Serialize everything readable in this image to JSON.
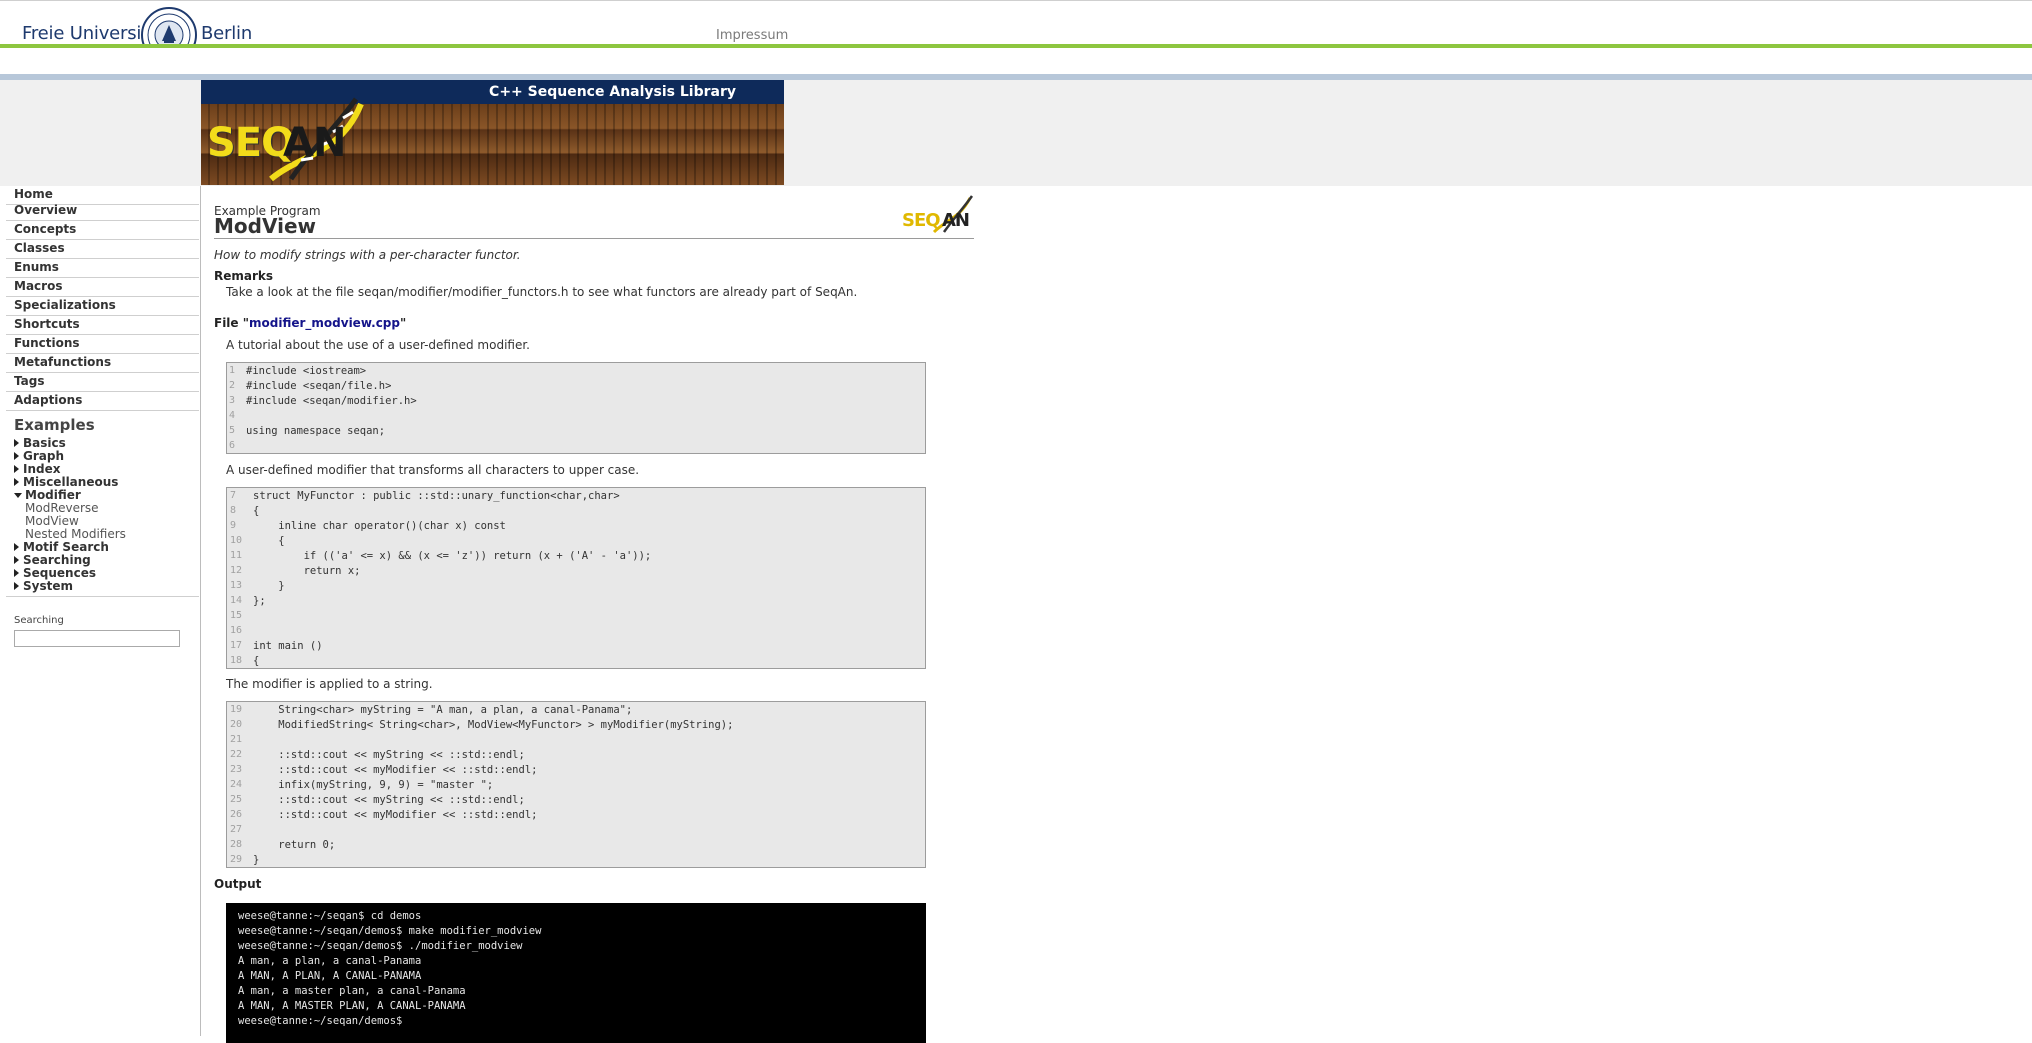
{
  "header": {
    "logo_left": "Freie Universität",
    "logo_right": "Berlin",
    "impressum": "Impressum"
  },
  "banner": {
    "tagline": "C++ Sequence Analysis Library",
    "logo_seq": "SEQ",
    "logo_an": "AN"
  },
  "sidebar": {
    "items": [
      "Home",
      "Overview",
      "Concepts",
      "Classes",
      "Enums",
      "Macros",
      "Specializations",
      "Shortcuts",
      "Functions",
      "Metafunctions",
      "Tags",
      "Adaptions"
    ],
    "examples_heading": "Examples",
    "examples": [
      {
        "label": "Basics",
        "expanded": false
      },
      {
        "label": "Graph",
        "expanded": false
      },
      {
        "label": "Index",
        "expanded": false
      },
      {
        "label": "Miscellaneous",
        "expanded": false
      },
      {
        "label": "Modifier",
        "expanded": true
      },
      {
        "label": "Motif Search",
        "expanded": false
      },
      {
        "label": "Searching",
        "expanded": false
      },
      {
        "label": "Sequences",
        "expanded": false
      },
      {
        "label": "System",
        "expanded": false
      }
    ],
    "modifier_children": [
      "ModReverse",
      "ModView",
      "Nested Modifiers"
    ],
    "search_label": "Searching",
    "search_value": ""
  },
  "main": {
    "overline": "Example Program",
    "title": "ModView",
    "logo_seq": "SEQ",
    "logo_an": "AN",
    "subtitle": "How to modify strings with a per-character functor.",
    "remarks_heading": "Remarks",
    "remarks_text": "Take a look at the file seqan/modifier/modifier_functors.h to see what functors are already part of SeqAn.",
    "file_prefix": "File \"",
    "file_name": "modifier_modview.cpp",
    "file_suffix": "\"",
    "para1": "A tutorial about the use of a user-defined modifier.",
    "code1": [
      {
        "n": "1",
        "t": "#include <iostream>"
      },
      {
        "n": "2",
        "t": "#include <seqan/file.h>"
      },
      {
        "n": "3",
        "t": "#include <seqan/modifier.h>"
      },
      {
        "n": "4",
        "t": ""
      },
      {
        "n": "5",
        "t": "using namespace seqan;"
      },
      {
        "n": "6",
        "t": ""
      }
    ],
    "para2": "A user-defined modifier that transforms all characters to upper case.",
    "code2": [
      {
        "n": "7",
        "t": "struct MyFunctor : public ::std::unary_function<char,char>"
      },
      {
        "n": "8",
        "t": "{"
      },
      {
        "n": "9",
        "t": "    inline char operator()(char x) const"
      },
      {
        "n": "10",
        "t": "    {"
      },
      {
        "n": "11",
        "t": "        if (('a' <= x) && (x <= 'z')) return (x + ('A' - 'a'));"
      },
      {
        "n": "12",
        "t": "        return x;"
      },
      {
        "n": "13",
        "t": "    }"
      },
      {
        "n": "14",
        "t": "};"
      },
      {
        "n": "15",
        "t": ""
      },
      {
        "n": "16",
        "t": ""
      },
      {
        "n": "17",
        "t": "int main ()"
      },
      {
        "n": "18",
        "t": "{"
      }
    ],
    "para3": "The modifier is applied to a string.",
    "code3": [
      {
        "n": "19",
        "t": "    String<char> myString = \"A man, a plan, a canal-Panama\";"
      },
      {
        "n": "20",
        "t": "    ModifiedString< String<char>, ModView<MyFunctor> > myModifier(myString);"
      },
      {
        "n": "21",
        "t": ""
      },
      {
        "n": "22",
        "t": "    ::std::cout << myString << ::std::endl;"
      },
      {
        "n": "23",
        "t": "    ::std::cout << myModifier << ::std::endl;"
      },
      {
        "n": "24",
        "t": "    infix(myString, 9, 9) = \"master \";"
      },
      {
        "n": "25",
        "t": "    ::std::cout << myString << ::std::endl;"
      },
      {
        "n": "26",
        "t": "    ::std::cout << myModifier << ::std::endl;"
      },
      {
        "n": "27",
        "t": ""
      },
      {
        "n": "28",
        "t": "    return 0;"
      },
      {
        "n": "29",
        "t": "}"
      }
    ],
    "output_heading": "Output",
    "output": [
      "weese@tanne:~/seqan$ cd demos",
      "weese@tanne:~/seqan/demos$ make modifier_modview",
      "weese@tanne:~/seqan/demos$ ./modifier_modview",
      "A man, a plan, a canal-Panama",
      "A MAN, A PLAN, A CANAL-PANAMA",
      "A man, a master plan, a canal-Panama",
      "A MAN, A MASTER PLAN, A CANAL-PANAMA",
      "weese@tanne:~/seqan/demos$"
    ]
  },
  "colors": {
    "accent_green": "#8dc63f",
    "band_blue": "#b7c7d9",
    "banner_navy": "#0e2a5a",
    "link": "#14148a"
  }
}
